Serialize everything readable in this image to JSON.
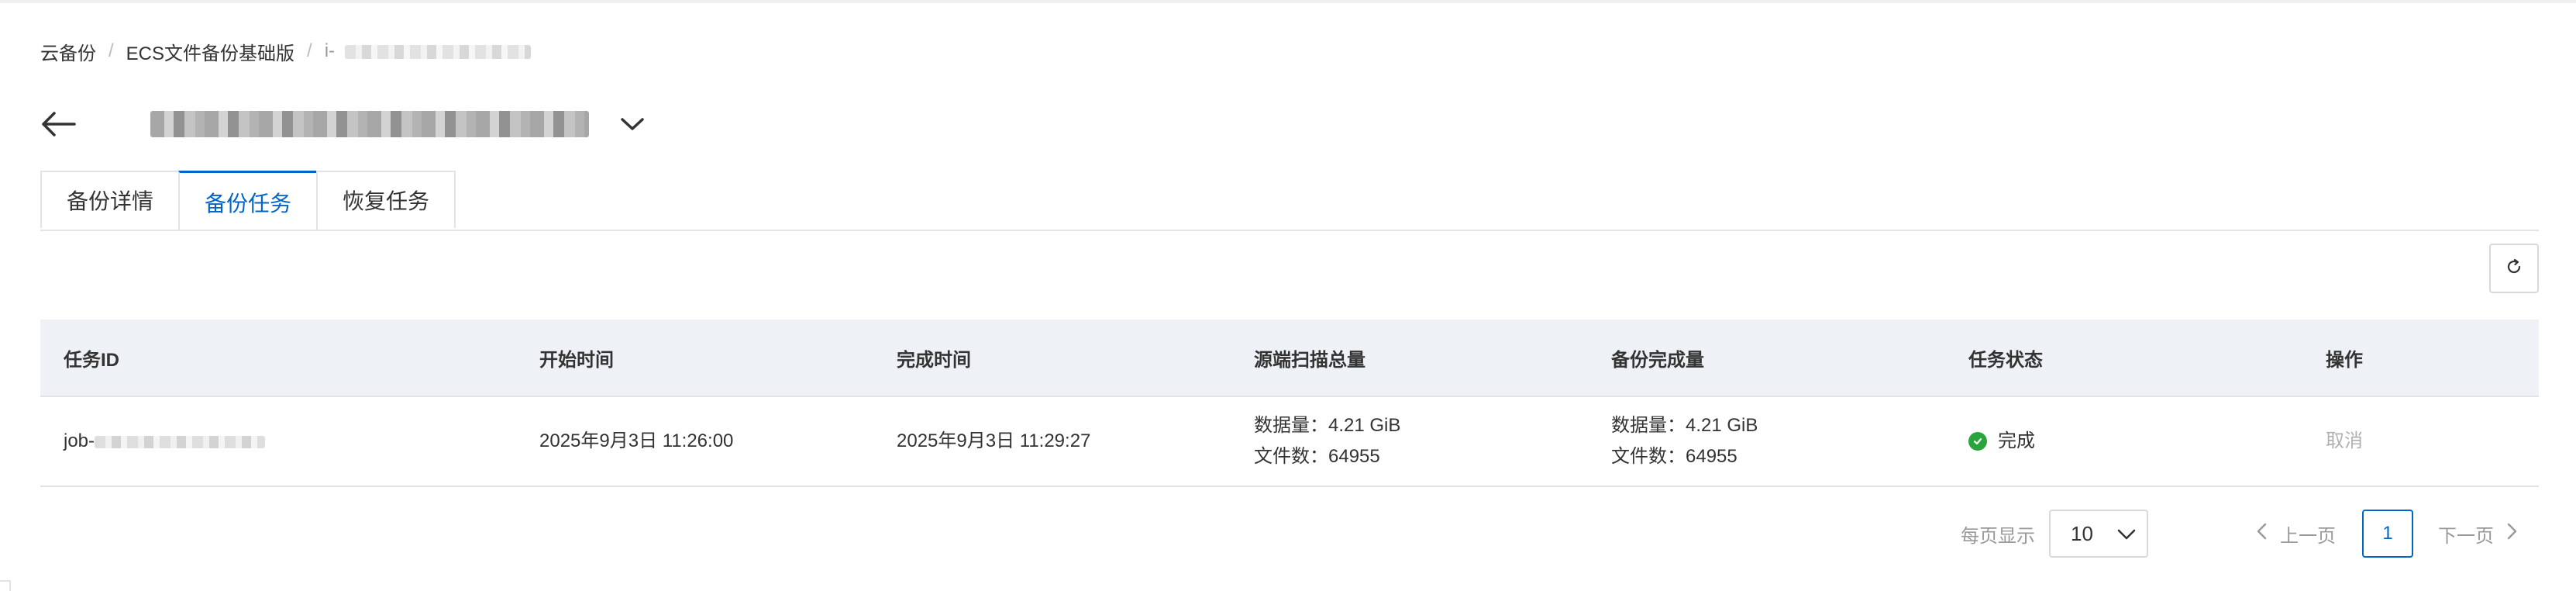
{
  "breadcrumb": {
    "item1": "云备份",
    "item2": "ECS文件备份基础版",
    "item3": "i-",
    "separator": "/"
  },
  "tabs": [
    {
      "label": "备份详情"
    },
    {
      "label": "备份任务"
    },
    {
      "label": "恢复任务"
    }
  ],
  "table": {
    "columns": [
      "任务ID",
      "开始时间",
      "完成时间",
      "源端扫描总量",
      "备份完成量",
      "任务状态",
      "操作"
    ],
    "rows": [
      {
        "job_id": "job-",
        "start_time": "2025年9月3日 11:26:00",
        "end_time": "2025年9月3日 11:29:27",
        "scan_data": "数据量：4.21 GiB",
        "scan_files": "文件数：64955",
        "backup_data": "数据量：4.21 GiB",
        "backup_files": "文件数：64955",
        "status": "完成",
        "action": "取消"
      }
    ]
  },
  "pagination": {
    "per_page_label": "每页显示",
    "page_size": "10",
    "prev": "上一页",
    "current_page": "1",
    "next": "下一页"
  },
  "colors": {
    "accent": "#0064c8",
    "success": "#2aa53d",
    "header_bg": "#eef1f5"
  },
  "icons": [
    "back-arrow-icon",
    "chevron-down-icon",
    "refresh-icon",
    "check-circle-icon",
    "chevron-left-icon",
    "chevron-right-icon"
  ]
}
